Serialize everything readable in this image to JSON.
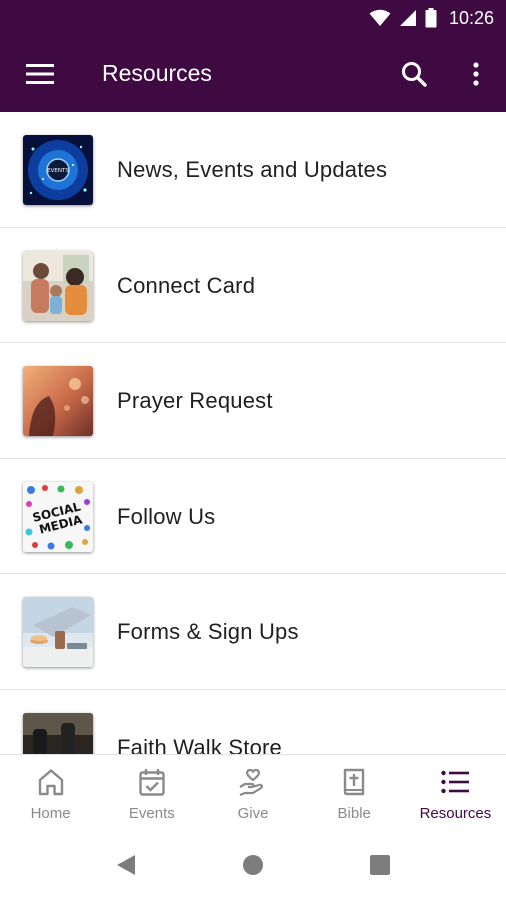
{
  "status_bar": {
    "time": "10:26"
  },
  "app_bar": {
    "title": "Resources"
  },
  "colors": {
    "primary": "#3f0a42",
    "nav_inactive": "#8a8a8a",
    "divider": "#e4e4e4"
  },
  "items": [
    {
      "label": "News, Events and Updates",
      "thumb_text": "EVENTS"
    },
    {
      "label": "Connect Card"
    },
    {
      "label": "Prayer Request"
    },
    {
      "label": "Follow Us",
      "thumb_text_1": "SOCIAL",
      "thumb_text_2": "MEDIA"
    },
    {
      "label": "Forms & Sign Ups"
    },
    {
      "label": "Faith Walk Store"
    }
  ],
  "bottom_nav": [
    {
      "label": "Home",
      "icon": "home-icon"
    },
    {
      "label": "Events",
      "icon": "calendar-check-icon"
    },
    {
      "label": "Give",
      "icon": "hand-heart-icon"
    },
    {
      "label": "Bible",
      "icon": "bible-icon"
    },
    {
      "label": "Resources",
      "icon": "list-icon",
      "active": true
    }
  ]
}
